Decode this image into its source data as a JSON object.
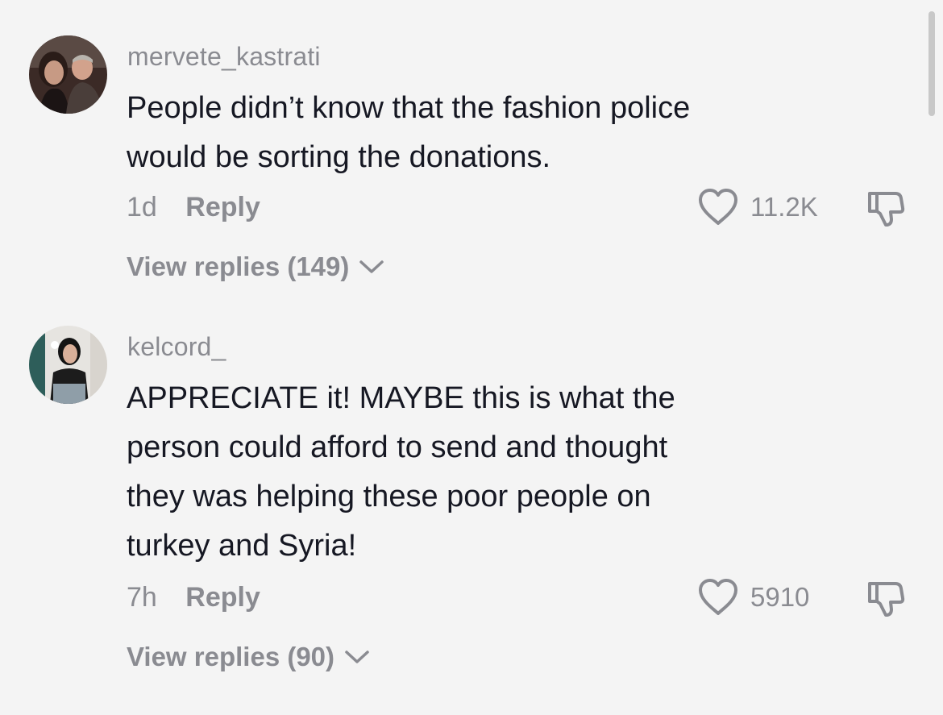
{
  "comments": [
    {
      "username": "mervete_kastrati",
      "text_lines": [
        "People didn’t know that the fashion police",
        "would be sorting the donations."
      ],
      "age": "1d",
      "reply_label": "Reply",
      "like_count": "11.2K",
      "view_replies": "View replies (149)",
      "avatar_icon": "avatar-photo-two-people",
      "like_icon": "heart-outline-icon",
      "dislike_icon": "thumbs-down-outline-icon"
    },
    {
      "username": "kelcord_",
      "text_lines": [
        "APPRECIATE it! MAYBE this is what the",
        "person could afford to send and thought",
        "they was helping these poor people on",
        "turkey and Syria!"
      ],
      "age": "7h",
      "reply_label": "Reply",
      "like_count": "5910",
      "view_replies": "View replies (90)",
      "avatar_icon": "avatar-photo-mirror-selfie",
      "like_icon": "heart-outline-icon",
      "dislike_icon": "thumbs-down-outline-icon"
    }
  ],
  "colors": {
    "background": "#f4f4f4",
    "primary_text": "#161823",
    "secondary_text": "#8a8b91",
    "icon_stroke": "#8a8b91",
    "scrollbar": "#c8c8c8"
  }
}
